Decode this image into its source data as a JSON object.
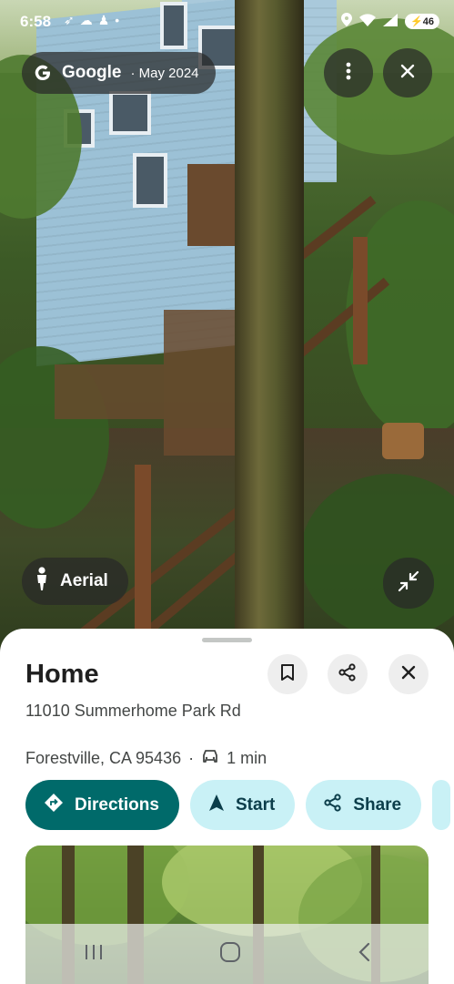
{
  "status_bar": {
    "time": "6:58",
    "battery": "46",
    "left_icons": [
      "navigation-icon",
      "cloud-icon",
      "snapchat-icon",
      "dot-icon"
    ],
    "right_icons": [
      "location-icon",
      "wifi-icon",
      "signal-icon",
      "battery-icon"
    ]
  },
  "street_view": {
    "source": "Google",
    "separator": "·",
    "date": "May 2024",
    "aerial_label": "Aerial"
  },
  "place": {
    "title": "Home",
    "address": "11010 Summerhome Park Rd",
    "locality": "Forestville, CA 95436",
    "dot": "·",
    "drive_time": "1 min"
  },
  "actions": {
    "directions": "Directions",
    "start": "Start",
    "share": "Share"
  },
  "colors": {
    "primary_button": "#006a6a",
    "secondary_button": "#c9f1f6",
    "sheet_bg": "#ffffff",
    "text_dark": "#1f1f1f",
    "text_muted": "#444746"
  }
}
